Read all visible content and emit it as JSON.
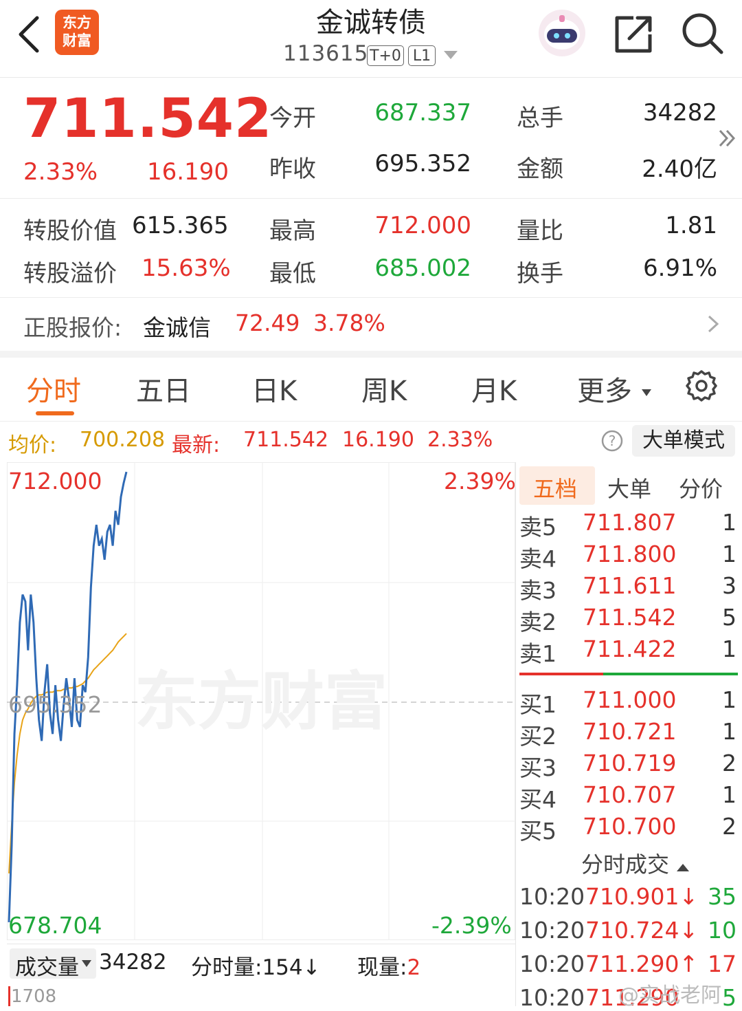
{
  "header": {
    "back_icon": "chevron-left-icon",
    "logo_text": [
      "东方",
      "财富"
    ],
    "title": "金诚转债",
    "code": "113615",
    "tags": [
      "T+0",
      "L1"
    ],
    "robot_icon": "robot-avatar-icon",
    "share_icon": "share-icon",
    "search_icon": "search-icon"
  },
  "quote": {
    "price": "711.542",
    "change_pct": "2.33%",
    "change_amt": "16.190",
    "rows": [
      {
        "l1": "今开",
        "v1": "687.337",
        "c1": "green",
        "l2": "总手",
        "v2": "34282",
        "c2": "dark"
      },
      {
        "l1": "昨收",
        "v1": "695.352",
        "c1": "dark",
        "l2": "金额",
        "v2": "2.40亿",
        "c2": "dark"
      }
    ],
    "more_icon": "double-chevron-right-icon"
  },
  "extra": {
    "conv_value_label": "转股价值",
    "conv_value": "615.365",
    "conv_premium_label": "转股溢价",
    "conv_premium": "15.63%",
    "high_label": "最高",
    "high": "712.000",
    "low_label": "最低",
    "low": "685.002",
    "vol_ratio_label": "量比",
    "vol_ratio": "1.81",
    "turnover_label": "换手",
    "turnover": "6.91%"
  },
  "underlying": {
    "label": "正股报价:",
    "name": "金诚信",
    "price": "72.49",
    "pct": "3.78%"
  },
  "tabs": [
    "分时",
    "五日",
    "日K",
    "周K",
    "月K",
    "更多"
  ],
  "active_tab": "分时",
  "infoline": {
    "avg_label": "均价:",
    "avg": "700.208",
    "latest_label": "最新:",
    "latest": "711.542",
    "chg": "16.190",
    "pct": "2.33%",
    "mode_button": "大单模式"
  },
  "chart_data": {
    "type": "line",
    "title": "",
    "ylim": [
      678.704,
      712.0
    ],
    "ref_price": "695.352",
    "y_top_label": "712.000",
    "y_bottom_label": "678.704",
    "pct_top": "2.39%",
    "pct_bottom": "-2.39%",
    "watermark": "东方财富",
    "series": [
      {
        "values": [
          679.5,
          685.0,
          693.0,
          696.5,
          701.0,
          703.0,
          702.5,
          699.0,
          703.0,
          701.0,
          697.0,
          694.0,
          692.5,
          696.0,
          698.0,
          694.5,
          693.0,
          696.5,
          694.0,
          692.5,
          695.0,
          697.0,
          695.5,
          693.5,
          697.0,
          694.0,
          693.5,
          696.5,
          696.0,
          698.5,
          703.5,
          706.5,
          708.0,
          706.5,
          707.0,
          705.5,
          707.5,
          708.0,
          706.5,
          709.0,
          708.0,
          710.0,
          711.0,
          711.8
        ]
      },
      {
        "values": [
          683.0,
          686.5,
          689.5,
          691.5,
          693.0,
          694.0,
          694.5,
          694.8,
          695.2,
          695.5,
          695.7,
          695.8,
          695.8,
          695.9,
          696.0,
          696.0,
          696.0,
          696.1,
          696.1,
          696.1,
          696.2,
          696.2,
          696.3,
          696.3,
          696.4,
          696.4,
          696.5,
          696.6,
          696.8,
          697.0,
          697.3,
          697.6,
          697.8,
          698.0,
          698.2,
          698.4,
          698.6,
          698.8,
          699.0,
          699.3,
          699.6,
          699.8,
          700.0,
          700.2
        ]
      }
    ]
  },
  "volume_bar": {
    "label": "成交量",
    "total": "34282",
    "tick_label": "分时量:",
    "tick_value": "154",
    "now_label": "现量:",
    "now_value": "2",
    "axis_value": "1708"
  },
  "order_book": {
    "tabs": [
      "五档",
      "大单",
      "分价"
    ],
    "asks": [
      {
        "label": "卖5",
        "price": "711.807",
        "vol": "1"
      },
      {
        "label": "卖4",
        "price": "711.800",
        "vol": "1"
      },
      {
        "label": "卖3",
        "price": "711.611",
        "vol": "3"
      },
      {
        "label": "卖2",
        "price": "711.542",
        "vol": "5"
      },
      {
        "label": "卖1",
        "price": "711.422",
        "vol": "1"
      }
    ],
    "bids": [
      {
        "label": "买1",
        "price": "711.000",
        "vol": "1"
      },
      {
        "label": "买2",
        "price": "710.721",
        "vol": "1"
      },
      {
        "label": "买3",
        "price": "710.719",
        "vol": "2"
      },
      {
        "label": "买4",
        "price": "710.707",
        "vol": "1"
      },
      {
        "label": "买5",
        "price": "710.700",
        "vol": "2"
      }
    ],
    "ticks_title": "分时成交",
    "ticks": [
      {
        "time": "10:20",
        "price": "710.901↓",
        "vol": "35",
        "color": "#e5312b",
        "vcolor": "#1ea83a"
      },
      {
        "time": "10:20",
        "price": "710.724↓",
        "vol": "10",
        "color": "#e5312b",
        "vcolor": "#1ea83a"
      },
      {
        "time": "10:20",
        "price": "711.290↑",
        "vol": "17",
        "color": "#e5312b",
        "vcolor": "#e5312b"
      },
      {
        "time": "10:20",
        "price": "711.290",
        "vol": "5",
        "color": "#e5312b",
        "vcolor": "#1ea83a"
      }
    ]
  },
  "watermark_corner": "@实战老阿"
}
